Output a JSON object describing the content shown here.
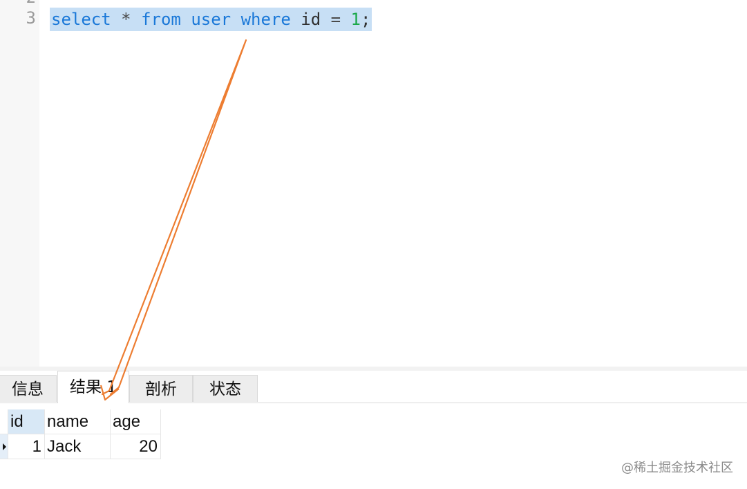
{
  "editor": {
    "line_partial": "2",
    "line_number": "3",
    "code_tokens": [
      {
        "text": "select",
        "cls": "kw"
      },
      {
        "text": " ",
        "cls": "id"
      },
      {
        "text": "*",
        "cls": "op"
      },
      {
        "text": " ",
        "cls": "id"
      },
      {
        "text": "from",
        "cls": "kw"
      },
      {
        "text": " ",
        "cls": "id"
      },
      {
        "text": "user",
        "cls": "kw"
      },
      {
        "text": " ",
        "cls": "id"
      },
      {
        "text": "where",
        "cls": "kw"
      },
      {
        "text": " ",
        "cls": "id"
      },
      {
        "text": "id",
        "cls": "id"
      },
      {
        "text": " ",
        "cls": "id"
      },
      {
        "text": "=",
        "cls": "op"
      },
      {
        "text": " ",
        "cls": "id"
      },
      {
        "text": "1",
        "cls": "num"
      },
      {
        "text": ";",
        "cls": "id"
      }
    ]
  },
  "tabs": [
    {
      "label": "信息"
    },
    {
      "label": "结果 1"
    },
    {
      "label": "剖析"
    },
    {
      "label": "状态"
    }
  ],
  "grid": {
    "columns": [
      "id",
      "name",
      "age"
    ],
    "rows": [
      {
        "id": "1",
        "name": "Jack",
        "age": "20"
      }
    ]
  },
  "colors": {
    "selection": "#c7dff5",
    "keyword": "#1a78d8",
    "number": "#1aa84a",
    "annotation_arrow": "#ed7d31"
  },
  "watermark": "@稀土掘金技术社区"
}
